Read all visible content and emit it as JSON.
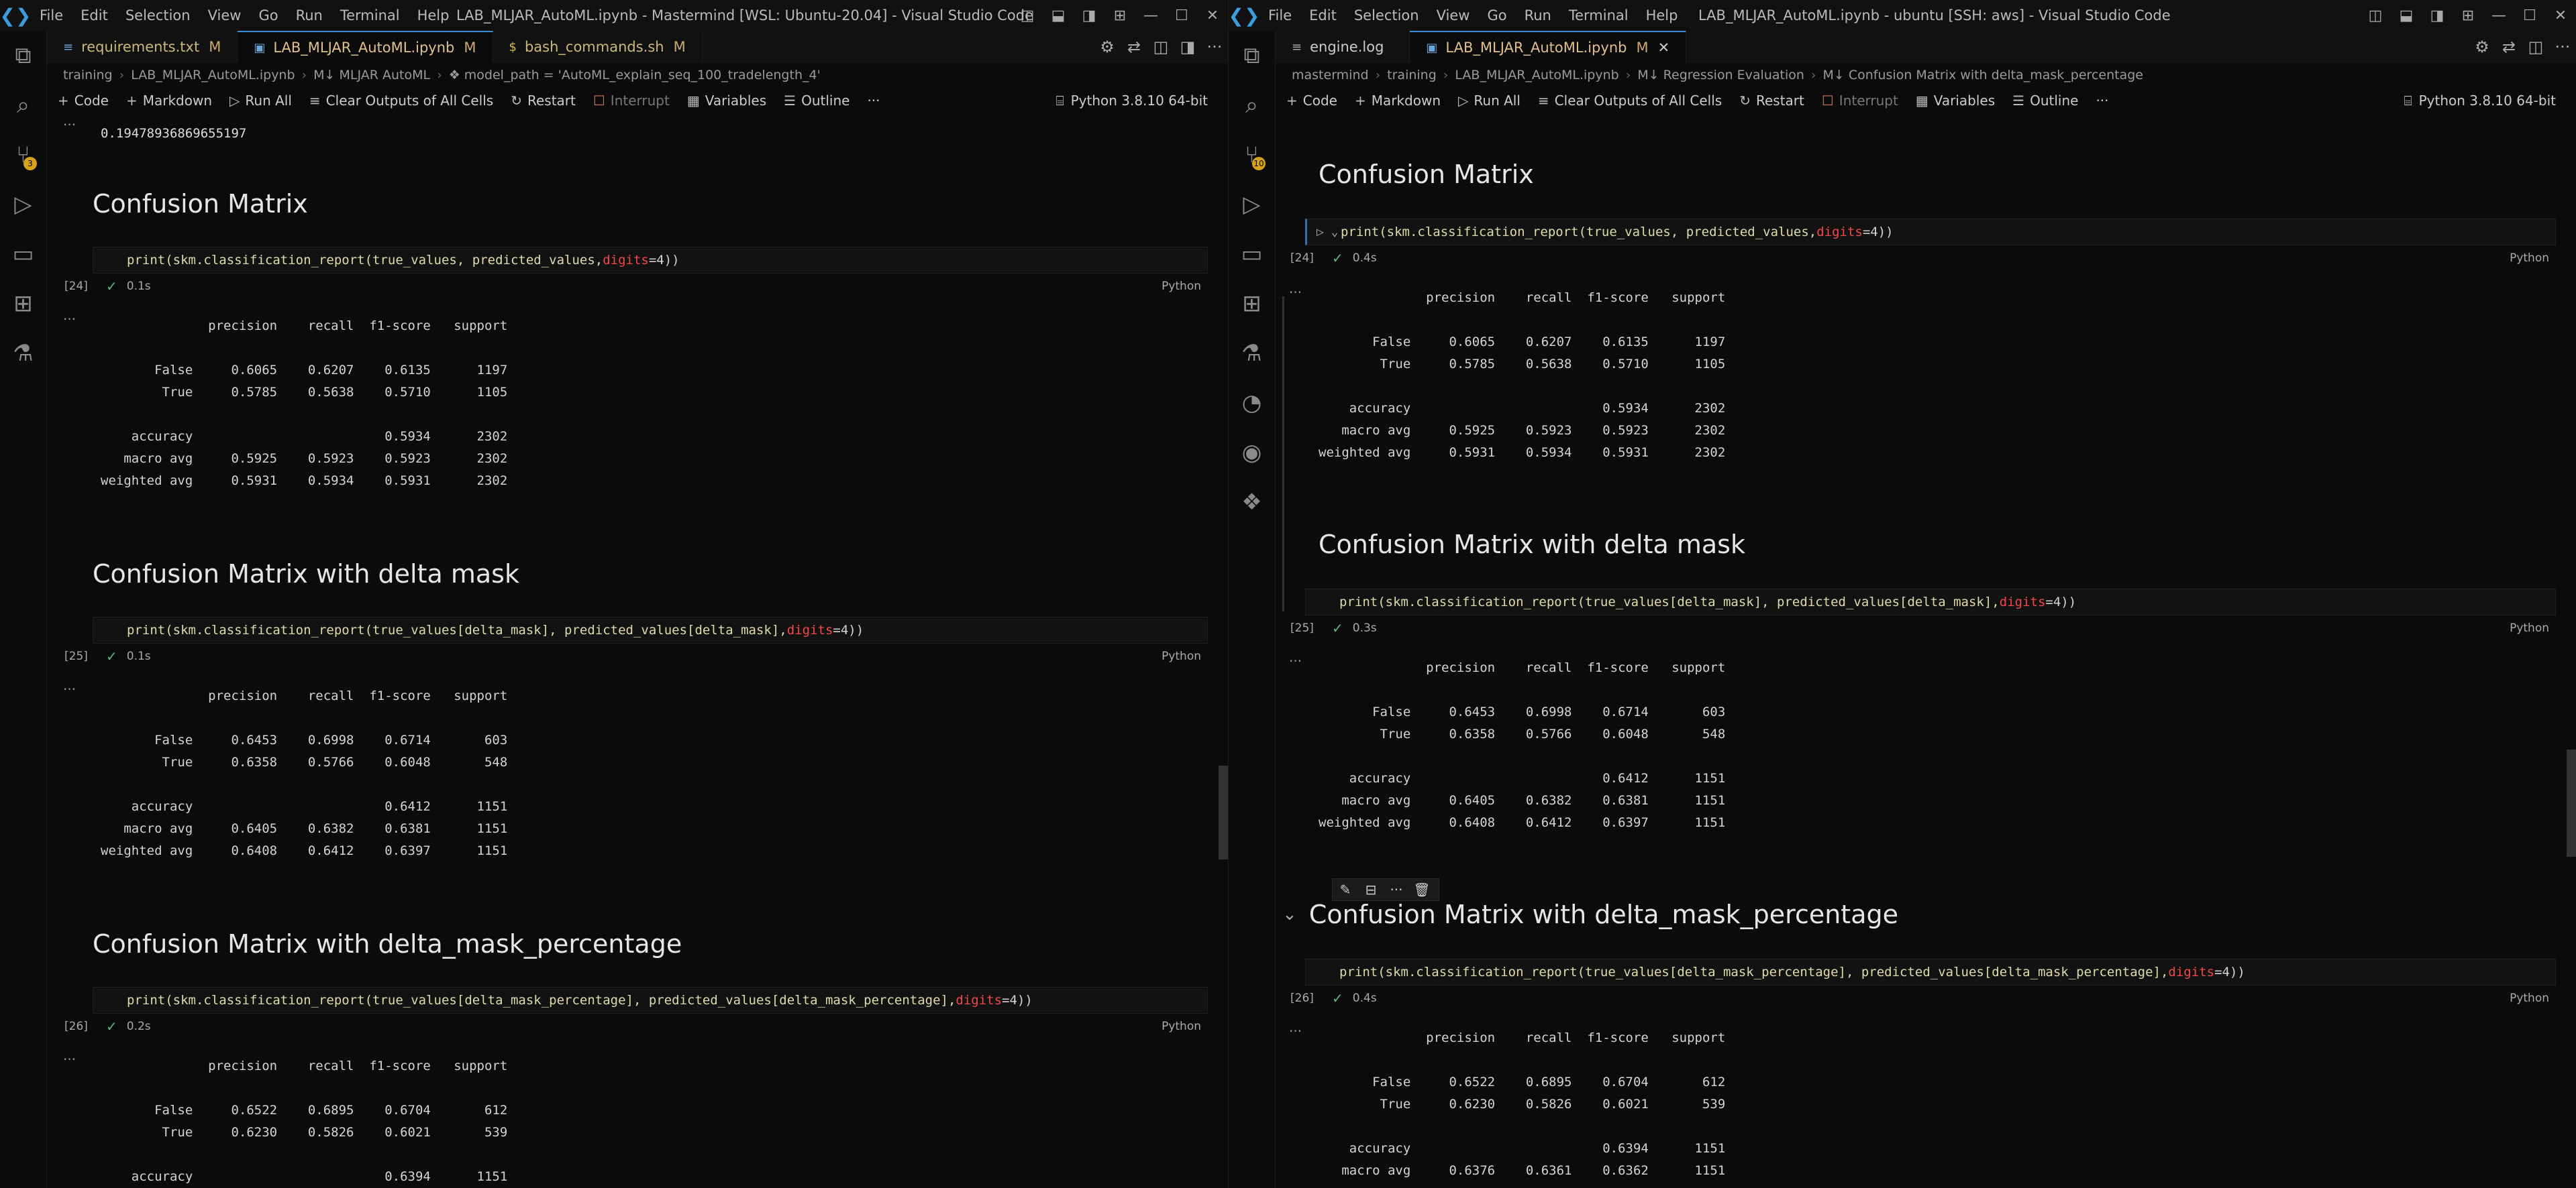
{
  "menu": [
    "File",
    "Edit",
    "Selection",
    "View",
    "Go",
    "Run",
    "Terminal",
    "Help"
  ],
  "left": {
    "title": "LAB_MLJAR_AutoML.ipynb - Mastermind [WSL: Ubuntu-20.04] - Visual Studio Code",
    "tabs": [
      {
        "icon": "≡",
        "label": "requirements.txt",
        "mod": "M"
      },
      {
        "icon": "▣",
        "label": "LAB_MLJAR_AutoML.ipynb",
        "mod": "M"
      },
      {
        "icon": "$",
        "label": "bash_commands.sh",
        "mod": "M"
      }
    ],
    "crumbs": [
      "training",
      "LAB_MLJAR_AutoML.ipynb",
      "M↓ MLJAR AutoML",
      "❖ model_path = 'AutoML_explain_seq_100_tradelength_4'"
    ],
    "source_control_badge": "3",
    "prev_output": "0.19478936869655197",
    "kernel": "Python 3.8.10 64-bit",
    "cells": [
      {
        "heading": "Confusion Matrix",
        "code_a": "print(skm.classification_report(true_values, predicted_values, ",
        "code_b": "digits",
        "code_c": "=4))",
        "count": "[24]",
        "time": "0.1s",
        "lang": "Python",
        "out": "              precision    recall  f1-score   support\n\n       False     0.6065    0.6207    0.6135      1197\n        True     0.5785    0.5638    0.5710      1105\n\n    accuracy                         0.5934      2302\n   macro avg     0.5925    0.5923    0.5923      2302\nweighted avg     0.5931    0.5934    0.5931      2302"
      },
      {
        "heading": "Confusion Matrix with delta mask",
        "code_a": "print(skm.classification_report(true_values[delta_mask], predicted_values[delta_mask], ",
        "code_b": "digits",
        "code_c": "=4))",
        "count": "[25]",
        "time": "0.1s",
        "lang": "Python",
        "out": "              precision    recall  f1-score   support\n\n       False     0.6453    0.6998    0.6714       603\n        True     0.6358    0.5766    0.6048       548\n\n    accuracy                         0.6412      1151\n   macro avg     0.6405    0.6382    0.6381      1151\nweighted avg     0.6408    0.6412    0.6397      1151"
      },
      {
        "heading": "Confusion Matrix with delta_mask_percentage",
        "code_a": "print(skm.classification_report(true_values[delta_mask_percentage], predicted_values[delta_mask_percentage], ",
        "code_b": "digits",
        "code_c": "=4))",
        "count": "[26]",
        "time": "0.2s",
        "lang": "Python",
        "out": "              precision    recall  f1-score   support\n\n       False     0.6522    0.6895    0.6704       612\n        True     0.6230    0.5826    0.6021       539\n\n    accuracy                         0.6394      1151"
      }
    ]
  },
  "right": {
    "title": "LAB_MLJAR_AutoML.ipynb - ubuntu [SSH: aws] - Visual Studio Code",
    "tabs": [
      {
        "icon": "≡",
        "label": "engine.log",
        "mod": ""
      },
      {
        "icon": "▣",
        "label": "LAB_MLJAR_AutoML.ipynb",
        "mod": "M"
      }
    ],
    "crumbs": [
      "mastermind",
      "training",
      "LAB_MLJAR_AutoML.ipynb",
      "M↓ Regression Evaluation",
      "M↓ Confusion Matrix with delta_mask_percentage"
    ],
    "source_control_badge": "10",
    "kernel": "Python 3.8.10 64-bit",
    "cells": [
      {
        "heading": "Confusion Matrix",
        "code_a": "print(skm.classification_report(true_values, predicted_values, ",
        "code_b": "digits",
        "code_c": "=4))",
        "count": "[24]",
        "time": "0.4s",
        "lang": "Python",
        "out": "              precision    recall  f1-score   support\n\n       False     0.6065    0.6207    0.6135      1197\n        True     0.5785    0.5638    0.5710      1105\n\n    accuracy                         0.5934      2302\n   macro avg     0.5925    0.5923    0.5923      2302\nweighted avg     0.5931    0.5934    0.5931      2302"
      },
      {
        "heading": "Confusion Matrix with delta mask",
        "code_a": "print(skm.classification_report(true_values[delta_mask], predicted_values[delta_mask], ",
        "code_b": "digits",
        "code_c": "=4))",
        "count": "[25]",
        "time": "0.3s",
        "lang": "Python",
        "out": "              precision    recall  f1-score   support\n\n       False     0.6453    0.6998    0.6714       603\n        True     0.6358    0.5766    0.6048       548\n\n    accuracy                         0.6412      1151\n   macro avg     0.6405    0.6382    0.6381      1151\nweighted avg     0.6408    0.6412    0.6397      1151"
      },
      {
        "heading": "Confusion Matrix with delta_mask_percentage",
        "code_a": "print(skm.classification_report(true_values[delta_mask_percentage], predicted_values[delta_mask_percentage], ",
        "code_b": "digits",
        "code_c": "=4))",
        "count": "[26]",
        "time": "0.4s",
        "lang": "Python",
        "out": "              precision    recall  f1-score   support\n\n       False     0.6522    0.6895    0.6704       612\n        True     0.6230    0.5826    0.6021       539\n\n    accuracy                         0.6394      1151\n   macro avg     0.6376    0.6361    0.6362      1151"
      }
    ]
  },
  "toolbar": {
    "code": "Code",
    "markdown": "Markdown",
    "run_all": "Run All",
    "clear": "Clear Outputs of All Cells",
    "restart": "Restart",
    "interrupt": "Interrupt",
    "variables": "Variables",
    "outline": "Outline",
    "more": "···"
  },
  "ellipsis": "···",
  "colors": {
    "accent": "#3b8ed6",
    "modified": "#e2c08d",
    "success": "#5fba7d",
    "keyword": "#f44747",
    "function": "#dcdcaa"
  }
}
